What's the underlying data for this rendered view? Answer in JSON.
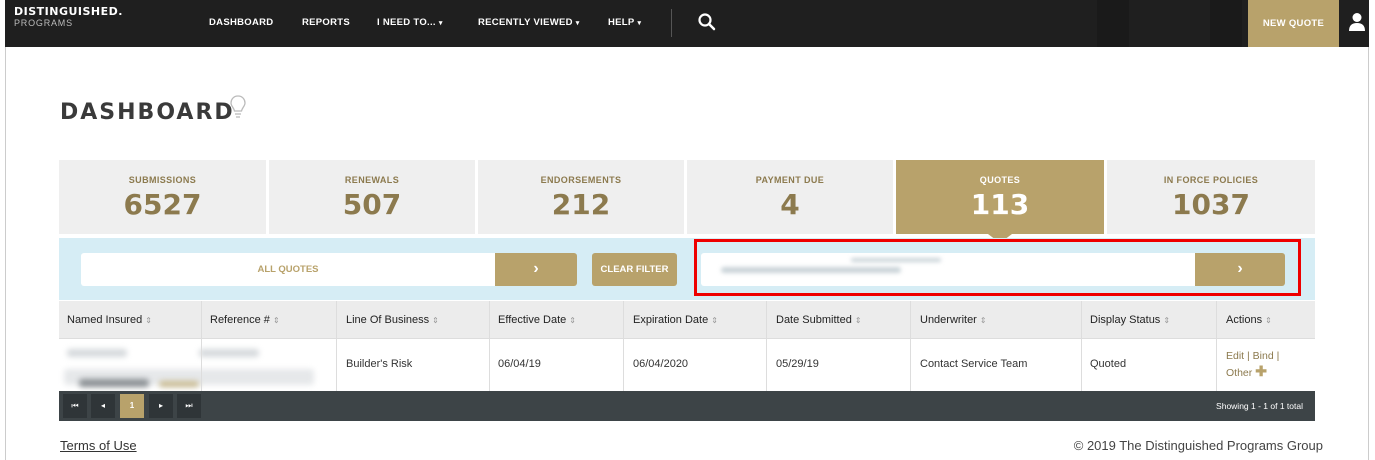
{
  "brand": {
    "line1": "DISTINGUISHED.",
    "line2": "PROGRAMS"
  },
  "nav": {
    "items": [
      {
        "label": "DASHBOARD",
        "caret": ""
      },
      {
        "label": "REPORTS",
        "caret": ""
      },
      {
        "label": "I NEED TO...",
        "caret": "▾"
      },
      {
        "label": "RECENTLY VIEWED",
        "caret": "▾"
      },
      {
        "label": "HELP",
        "caret": "▾"
      }
    ],
    "new_quote": "NEW QUOTE"
  },
  "page_title": "DASHBOARD",
  "tiles": [
    {
      "label": "SUBMISSIONS",
      "value": "6527"
    },
    {
      "label": "RENEWALS",
      "value": "507"
    },
    {
      "label": "ENDORSEMENTS",
      "value": "212"
    },
    {
      "label": "PAYMENT DUE",
      "value": "4"
    },
    {
      "label": "QUOTES",
      "value": "113"
    },
    {
      "label": "IN FORCE POLICIES",
      "value": "1037"
    }
  ],
  "filter": {
    "selected": "ALL QUOTES",
    "go_glyph": "›",
    "clear": "CLEAR FILTER",
    "search_go_glyph": "›"
  },
  "table": {
    "headers": [
      "Named Insured",
      "Reference #",
      "Line Of Business",
      "Effective Date",
      "Expiration Date",
      "Date Submitted",
      "Underwriter",
      "Display Status",
      "Actions"
    ],
    "sort_glyph": "⇕",
    "row": {
      "line_of_business": "Builder's Risk",
      "effective_date": "06/04/19",
      "expiration_date": "06/04/2020",
      "date_submitted": "05/29/19",
      "underwriter": "Contact Service Team",
      "display_status": "Quoted",
      "action_edit": "Edit",
      "action_bind": "Bind",
      "action_other": "Other",
      "sep": "|"
    }
  },
  "pager": {
    "first": "⏮",
    "prev": "◂",
    "current": "1",
    "next": "▸",
    "last": "⏭",
    "info": "Showing 1 - 1 of 1 total"
  },
  "footer": {
    "terms": "Terms of Use",
    "copyright": "© 2019 The Distinguished Programs Group"
  },
  "colors": {
    "accent": "#b8a26b",
    "nav_bg": "#1f1f1f",
    "filter_bg": "#d6edf5",
    "highlight": "#ee0000"
  },
  "icons": {
    "search": "search-icon",
    "user": "user-icon",
    "bulb": "lightbulb-icon",
    "plus": "plus-icon"
  }
}
